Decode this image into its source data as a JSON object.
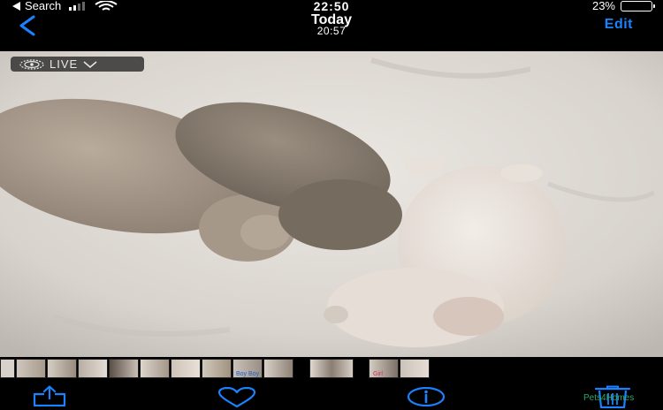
{
  "status_bar": {
    "back_app": "Search",
    "time": "22:50",
    "battery_percent": "23%",
    "battery_level": 0.23,
    "battery_color": "#f5c518"
  },
  "nav": {
    "back_icon": "chevron-left-icon",
    "title": "Today",
    "subtitle": "20:57",
    "edit_label": "Edit",
    "accent": "#1a82ff"
  },
  "photo": {
    "live_label": "LIVE"
  },
  "thumbnails": {
    "count": 13,
    "captions": [
      "Boy",
      "Boy",
      "Girl"
    ]
  },
  "toolbar": {
    "share_icon": "share-icon",
    "favorite_icon": "heart-icon",
    "info_icon": "info-icon",
    "delete_icon": "trash-icon"
  },
  "watermark": "Pets4Homes"
}
